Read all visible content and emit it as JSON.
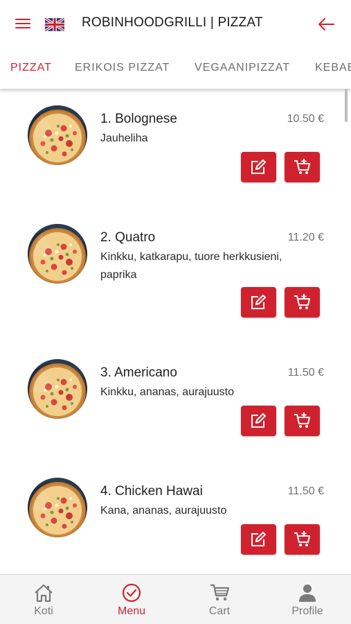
{
  "header": {
    "title": "ROBINHOODGRILLI | PIZZAT",
    "menu_icon": "hamburger-menu-icon",
    "language_icon": "uk-flag-icon",
    "back_icon": "arrow-left-icon"
  },
  "colors": {
    "accent": "#d0222e",
    "tab_inactive": "#6e6e6e",
    "nav_inactive": "#7a7a7a"
  },
  "tabs": [
    {
      "label": "PIZZAT",
      "active": true
    },
    {
      "label": "ERIKOIS PIZZAT",
      "active": false
    },
    {
      "label": "VEGAANIPIZZAT",
      "active": false
    },
    {
      "label": "KEBAB",
      "active": false
    }
  ],
  "items": [
    {
      "name": "1. Bolognese",
      "price": "10.50 €",
      "description": "Jauheliha"
    },
    {
      "name": "2. Quatro",
      "price": "11.20 €",
      "description": "Kinkku, katkarapu, tuore herkkusieni, paprika"
    },
    {
      "name": "3. Americano",
      "price": "11.50 €",
      "description": "Kinkku, ananas, aurajuusto"
    },
    {
      "name": "4. Chicken Hawai",
      "price": "11.50 €",
      "description": "Kana, ananas, aurajuusto"
    }
  ],
  "item_actions": {
    "edit_icon": "edit-icon",
    "add_to_cart_icon": "cart-add-icon"
  },
  "bottom_nav": [
    {
      "label": "Koti",
      "icon": "home-icon",
      "active": false
    },
    {
      "label": "Menu",
      "icon": "check-circle-icon",
      "active": true
    },
    {
      "label": "Cart",
      "icon": "cart-icon",
      "active": false
    },
    {
      "label": "Profile",
      "icon": "person-icon",
      "active": false
    }
  ]
}
